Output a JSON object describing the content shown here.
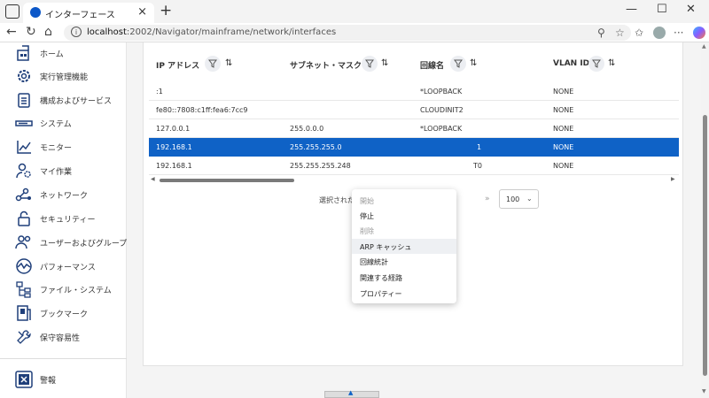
{
  "browser": {
    "tab_title": "インターフェース",
    "tab_close": "×",
    "new_tab": "+",
    "url_host": "localhost",
    "url_path": ":2002/Navigator/mainframe/network/interfaces",
    "min": "—",
    "max": "☐",
    "close": "✕"
  },
  "sidebar": {
    "items": [
      {
        "label": "ホーム",
        "icon": "home-icon"
      },
      {
        "label": "実行管理機能",
        "icon": "gear-icon"
      },
      {
        "label": "構成およびサービス",
        "icon": "clipboard-icon"
      },
      {
        "label": "システム",
        "icon": "server-icon"
      },
      {
        "label": "モニター",
        "icon": "chart-line-icon"
      },
      {
        "label": "マイ作業",
        "icon": "person-gear-icon"
      },
      {
        "label": "ネットワーク",
        "icon": "network-icon"
      },
      {
        "label": "セキュリティー",
        "icon": "lock-icon"
      },
      {
        "label": "ユーザーおよびグループ",
        "icon": "users-icon"
      },
      {
        "label": "パフォーマンス",
        "icon": "performance-icon"
      },
      {
        "label": "ファイル・システム",
        "icon": "file-tree-icon"
      },
      {
        "label": "ブックマーク",
        "icon": "bookmark-icon"
      },
      {
        "label": "保守容易性",
        "icon": "wrench-icon"
      }
    ],
    "alert": {
      "label": "警報",
      "icon": "alert-icon"
    }
  },
  "table": {
    "columns": [
      "IP アドレス",
      "サブネット・マスク",
      "回線名",
      "VLAN ID"
    ],
    "rows": [
      [
        ":1",
        "",
        "*LOOPBACK",
        "NONE"
      ],
      [
        "fe80::7808:c1ff:fea6:7cc9",
        "",
        "CLOUDINIT2",
        "NONE"
      ],
      [
        "127.0.0.1",
        "255.0.0.0",
        "*LOOPBACK",
        "NONE"
      ],
      [
        "192.168.1",
        "255.255.255.0",
        "1",
        "NONE"
      ],
      [
        "192.168.1",
        "255.255.255.248",
        "T0",
        "NONE"
      ]
    ],
    "selected_row": 3
  },
  "pager": {
    "selected_text": "選択された行: 1",
    "next": "»",
    "page_size": "100",
    "caret": "⌄"
  },
  "context_menu": {
    "items": [
      {
        "label": "開始",
        "disabled": true
      },
      {
        "label": "停止",
        "disabled": false
      },
      {
        "label": "削除",
        "disabled": true
      },
      {
        "label": "ARP キャッシュ",
        "disabled": false
      },
      {
        "label": "回線統計",
        "disabled": false
      },
      {
        "label": "関連する経路",
        "disabled": false
      },
      {
        "label": "プロパティー",
        "disabled": false
      }
    ],
    "hover_index": 3
  },
  "colors": {
    "accent": "#0f62c6",
    "sidebar_icon": "#1f3f7a"
  }
}
